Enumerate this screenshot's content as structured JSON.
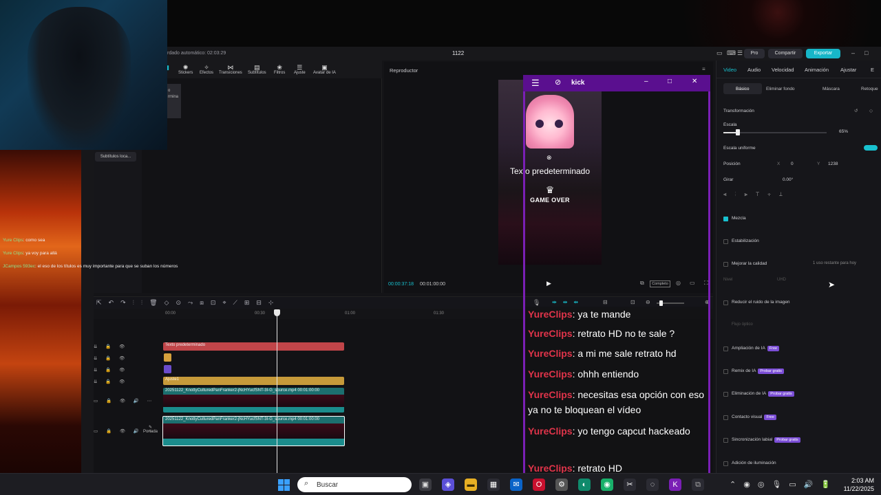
{
  "capcut": {
    "autosave": "rdado automático: 02:03:29",
    "project_title": "1122",
    "pro_label": "Pro",
    "share_label": "Compartir",
    "export_label": "Exportar",
    "toolbar": [
      {
        "label": "Stickers",
        "icon": "sticker-icon"
      },
      {
        "label": "Efectos",
        "icon": "effects-icon"
      },
      {
        "label": "Transiciones",
        "icon": "transition-icon"
      },
      {
        "label": "Subtítulos",
        "icon": "subtitles-icon"
      },
      {
        "label": "Filtros",
        "icon": "filter-icon"
      },
      {
        "label": "Ajuste",
        "icon": "adjust-icon"
      },
      {
        "label": "Avatar de IA",
        "icon": "avatar-icon"
      }
    ],
    "media_card_text": "o\nrmina",
    "subs_local": "Subtítulos loca...",
    "player": {
      "title": "Reproductor",
      "overlay_text": "Texto predeterminado",
      "game_over": "GAME OVER",
      "timecode": "00:00:37:18",
      "duration": "00:01:00:00",
      "complete_label": "Completo"
    },
    "timeline": {
      "ruler": [
        "00:00",
        "00:30",
        "01:00",
        "01:30"
      ],
      "text_clip": "Texto predeterminado",
      "adjust_clip": "Ajuste1",
      "video_clip_1": "20251122_KnottyCulturedPanFranker2-jNcHYucfSNT-3I-G_source.mp4   00:01:00:00",
      "video_clip_2": "20251122_KnottyCulturedPanFranker2-jNcHYucfSNT-3I-G_source.mp4   00:01:00:00",
      "cover_label": "Portada"
    },
    "inspector": {
      "tabs": [
        "Video",
        "Audio",
        "Velocidad",
        "Animación",
        "Ajustar",
        "E"
      ],
      "active_tab": "Video",
      "subtabs": [
        "Básico",
        "Eliminar fondo",
        "Máscara",
        "Retoque"
      ],
      "transform_label": "Transformación",
      "scale_label": "Escala",
      "scale_value": "65%",
      "uniform_scale_label": "Escala uniforme",
      "position_label": "Posición",
      "pos_x_label": "X",
      "pos_x": "0",
      "pos_y_label": "Y",
      "pos_y": "1238",
      "rotate_label": "Girar",
      "rotate_value": "0.00°",
      "blend_label": "Mezcla",
      "stabilize_label": "Estabilización",
      "quality_label": "Mejorar la calidad",
      "quality_note": "1 uso restante para hoy",
      "mode_label": "Nivel",
      "mode_value": "UHD",
      "denoise_label": "Reducir el ruido de la imagen",
      "flow_label": "Flujo óptico",
      "ai_expand_label": "Ampliación de IA",
      "ai_remix_label": "Remix de IA",
      "ai_remove_label": "Eliminación de IA",
      "eye_contact_label": "Contacto visual",
      "lip_sync_label": "Sincronización labial",
      "lighting_label": "Adición de iluminación",
      "badge_free": "Free",
      "badge_try": "Probar gratis"
    }
  },
  "kick": {
    "title": "kick",
    "messages": [
      {
        "user": "YureClips",
        "text": ": ya te mande"
      },
      {
        "user": "YureClips",
        "text": ": retrato HD no te sale ?"
      },
      {
        "user": "YureClips",
        "text": ": a mi me sale retrato hd"
      },
      {
        "user": "YureClips",
        "text": ": ohhh entiendo"
      },
      {
        "user": "YureClips",
        "text": ": necesitas esa opción con eso ya no te bloquean el vídeo"
      },
      {
        "user": "YureClips",
        "text": ": yo tengo capcut hackeado"
      },
      {
        "user": "YureClips",
        "text": ": retrato HD"
      }
    ]
  },
  "stream_chat": [
    {
      "user": "Yure Clips",
      "text": ": como sea"
    },
    {
      "user": "Yure Clips",
      "text": ": ya voy para allá"
    },
    {
      "user": "JCampos 593ec",
      "text": ": el eso de los títulos es muy importante para que se suban los números"
    }
  ],
  "taskbar": {
    "search_placeholder": "Buscar",
    "time": "2:03 AM",
    "date": "11/22/2025"
  },
  "colors": {
    "accent": "#18c1cf",
    "kick_purple": "#7a1fb5",
    "chat_user": "#e0344a"
  }
}
